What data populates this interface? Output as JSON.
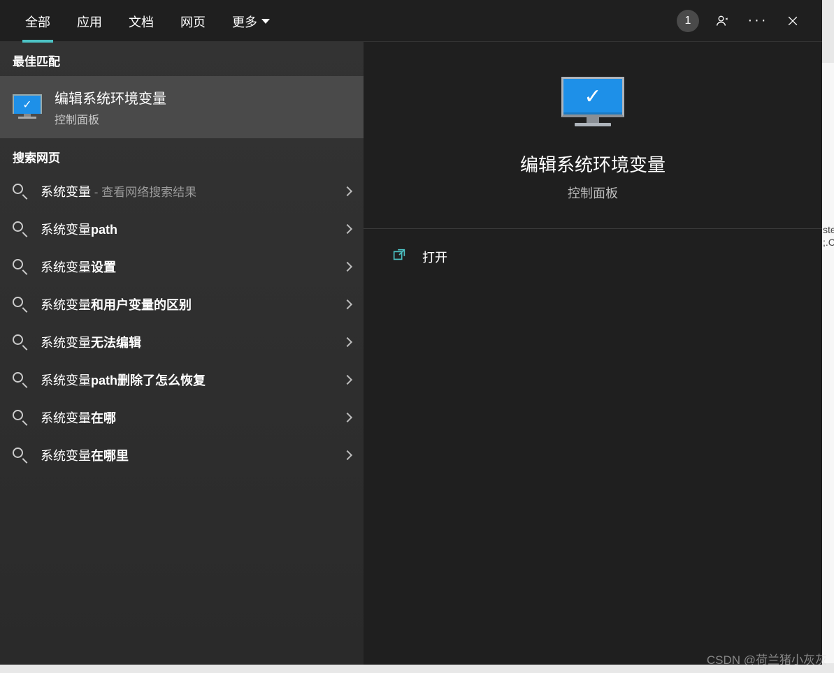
{
  "tabs": {
    "all": "全部",
    "apps": "应用",
    "docs": "文档",
    "web": "网页",
    "more": "更多"
  },
  "header": {
    "badge": "1"
  },
  "left": {
    "best_match_header": "最佳匹配",
    "best_match": {
      "title": "编辑系统环境变量",
      "subtitle": "控制面板"
    },
    "search_web_header": "搜索网页",
    "items": [
      {
        "prefix": "系统变量",
        "bold": "",
        "hint": " - 查看网络搜索结果"
      },
      {
        "prefix": "系统变量",
        "bold": "path",
        "hint": ""
      },
      {
        "prefix": "系统变量",
        "bold": "设置",
        "hint": ""
      },
      {
        "prefix": "系统变量",
        "bold": "和用户变量的区别",
        "hint": ""
      },
      {
        "prefix": "系统变量",
        "bold": "无法编辑",
        "hint": ""
      },
      {
        "prefix": "系统变量",
        "bold": "path删除了怎么恢复",
        "hint": ""
      },
      {
        "prefix": "系统变量",
        "bold": "在哪",
        "hint": ""
      },
      {
        "prefix": "系统变量",
        "bold": "在哪里",
        "hint": ""
      }
    ]
  },
  "detail": {
    "title": "编辑系统环境变量",
    "subtitle": "控制面板",
    "open": "打开"
  },
  "bg": {
    "line1": "ste",
    "line2": ";.C"
  },
  "watermark": "CSDN @荷兰猪小灰灰"
}
